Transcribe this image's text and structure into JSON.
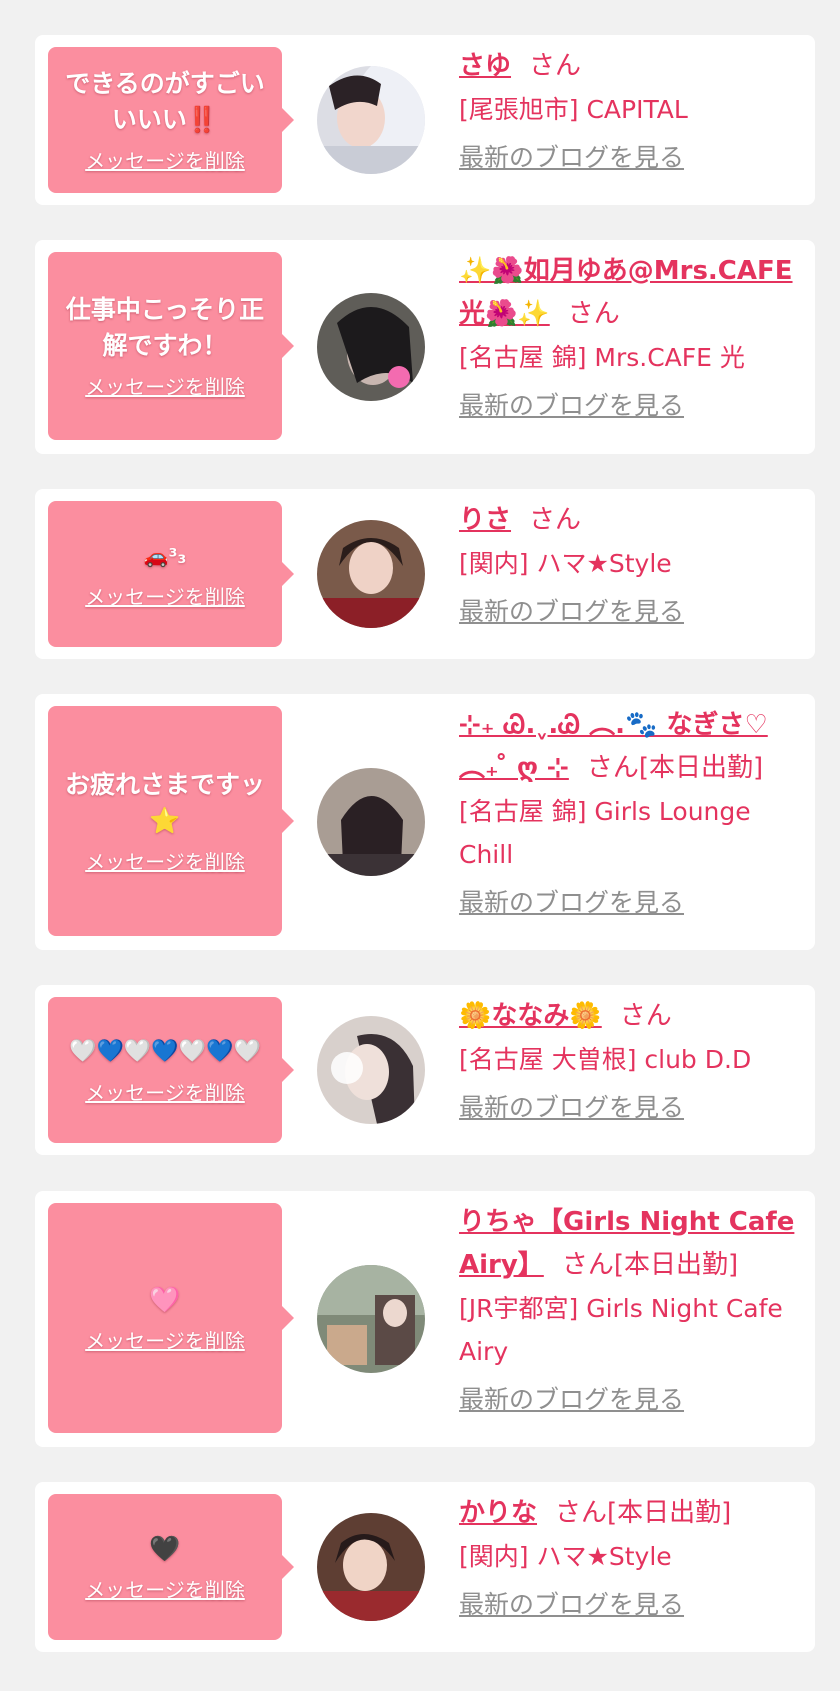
{
  "delete_label": "メッセージを削除",
  "blog_label": "最新のブログを見る",
  "colors": {
    "accent": "#e4335e",
    "bubble": "#fb8e9f",
    "link_gray": "#8f8f8f",
    "background": "#f1f1f1"
  },
  "messages": [
    {
      "message": "できるのがすごい いいい‼️",
      "name": "さゆ",
      "suffix": "さん",
      "shop": "[尾張旭市] CAPITAL",
      "avatar_icon": "profile-photo"
    },
    {
      "message": "仕事中こっそり正解ですわ！",
      "name": "✨🌺如月ゆあ@Mrs.CAFE光🌺✨",
      "suffix": "さん",
      "shop": "[名古屋 錦] Mrs.CAFE 光",
      "avatar_icon": "profile-photo"
    },
    {
      "message": "🚗³₃",
      "name": "りさ",
      "suffix": "さん",
      "shop": "[関内] ハマ★Style",
      "avatar_icon": "profile-photo"
    },
    {
      "message": "お疲れさまですッ⭐",
      "name": "⊹₊ Ꮚ.ˬ.Ꮚ ︵.🐾 なぎさ♡︵₊ ̊ ღ ⊹",
      "suffix": "さん[本日出勤]",
      "shop": "[名古屋 錦] Girls Lounge Chill",
      "avatar_icon": "profile-photo"
    },
    {
      "message": "🤍💙🤍💙🤍💙🤍",
      "name": "🌼ななみ🌼",
      "suffix": "さん",
      "shop": "[名古屋 大曽根] club D.D",
      "avatar_icon": "profile-photo"
    },
    {
      "message": "🩷",
      "name": "りちゃ【Girls Night Cafe Airy】",
      "suffix": "さん[本日出勤]",
      "shop": "[JR宇都宮] Girls Night Cafe Airy",
      "avatar_icon": "profile-photo"
    },
    {
      "message": "🖤",
      "name": "かりな",
      "suffix": "さん[本日出勤]",
      "shop": "[関内] ハマ★Style",
      "avatar_icon": "profile-photo"
    }
  ]
}
